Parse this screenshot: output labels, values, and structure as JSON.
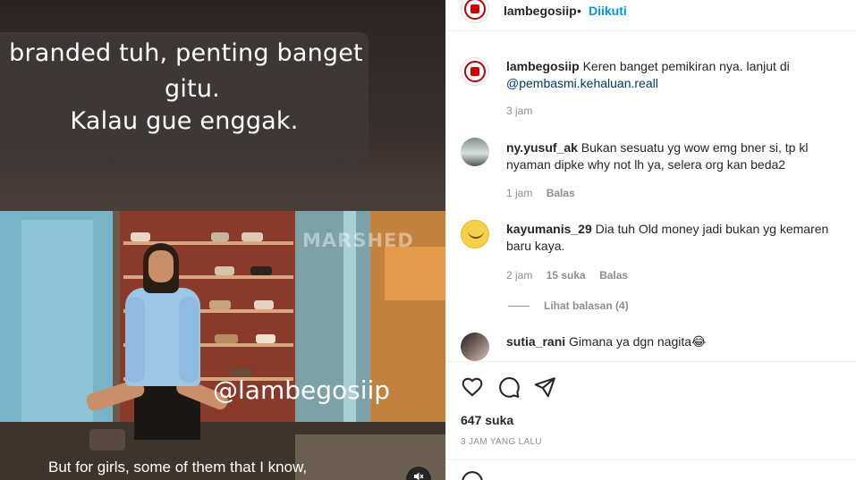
{
  "video": {
    "caption_lines": [
      "branded tuh, penting banget",
      "gitu.",
      "Kalau gue enggak."
    ],
    "watermark": "MARSHED",
    "handle": "@lambegosiip",
    "subtitle": "But for girls, some of them that I know,"
  },
  "post": {
    "author": "lambegosiip",
    "separator": "•",
    "follow_label": "Diikuti",
    "likes": "647 suka",
    "timestamp": "3 JAM YANG LALU"
  },
  "comments": [
    {
      "user": "lambegosiip",
      "text": "Keren banget pemikiran nya. lanjut di",
      "mention": "@pembasmi.kehaluan.reall",
      "time": "3 jam"
    },
    {
      "user": "ny.yusuf_ak",
      "text": "Bukan sesuatu yg wow emg bner si, tp kl nyaman dipke why not lh ya, selera org kan beda2",
      "time": "1 jam",
      "reply": "Balas"
    },
    {
      "user": "kayumanis_29",
      "text": "Dia tuh Old money jadi bukan yg kemaren baru kaya.",
      "time": "2 jam",
      "likes": "15 suka",
      "reply": "Balas",
      "view_replies": "Lihat balasan (4)"
    },
    {
      "user": "sutia_rani",
      "text": "Gimana ya dgn nagita😂"
    }
  ],
  "icons": {
    "like": "heart-outline-icon",
    "comment": "speech-bubble-icon",
    "share": "paper-plane-icon",
    "mute": "speaker-muted-icon",
    "emoji": "emoji-icon"
  },
  "colors": {
    "accent": "#0095f6",
    "mention": "#00376b",
    "muted_text": "#8e8e8e"
  }
}
